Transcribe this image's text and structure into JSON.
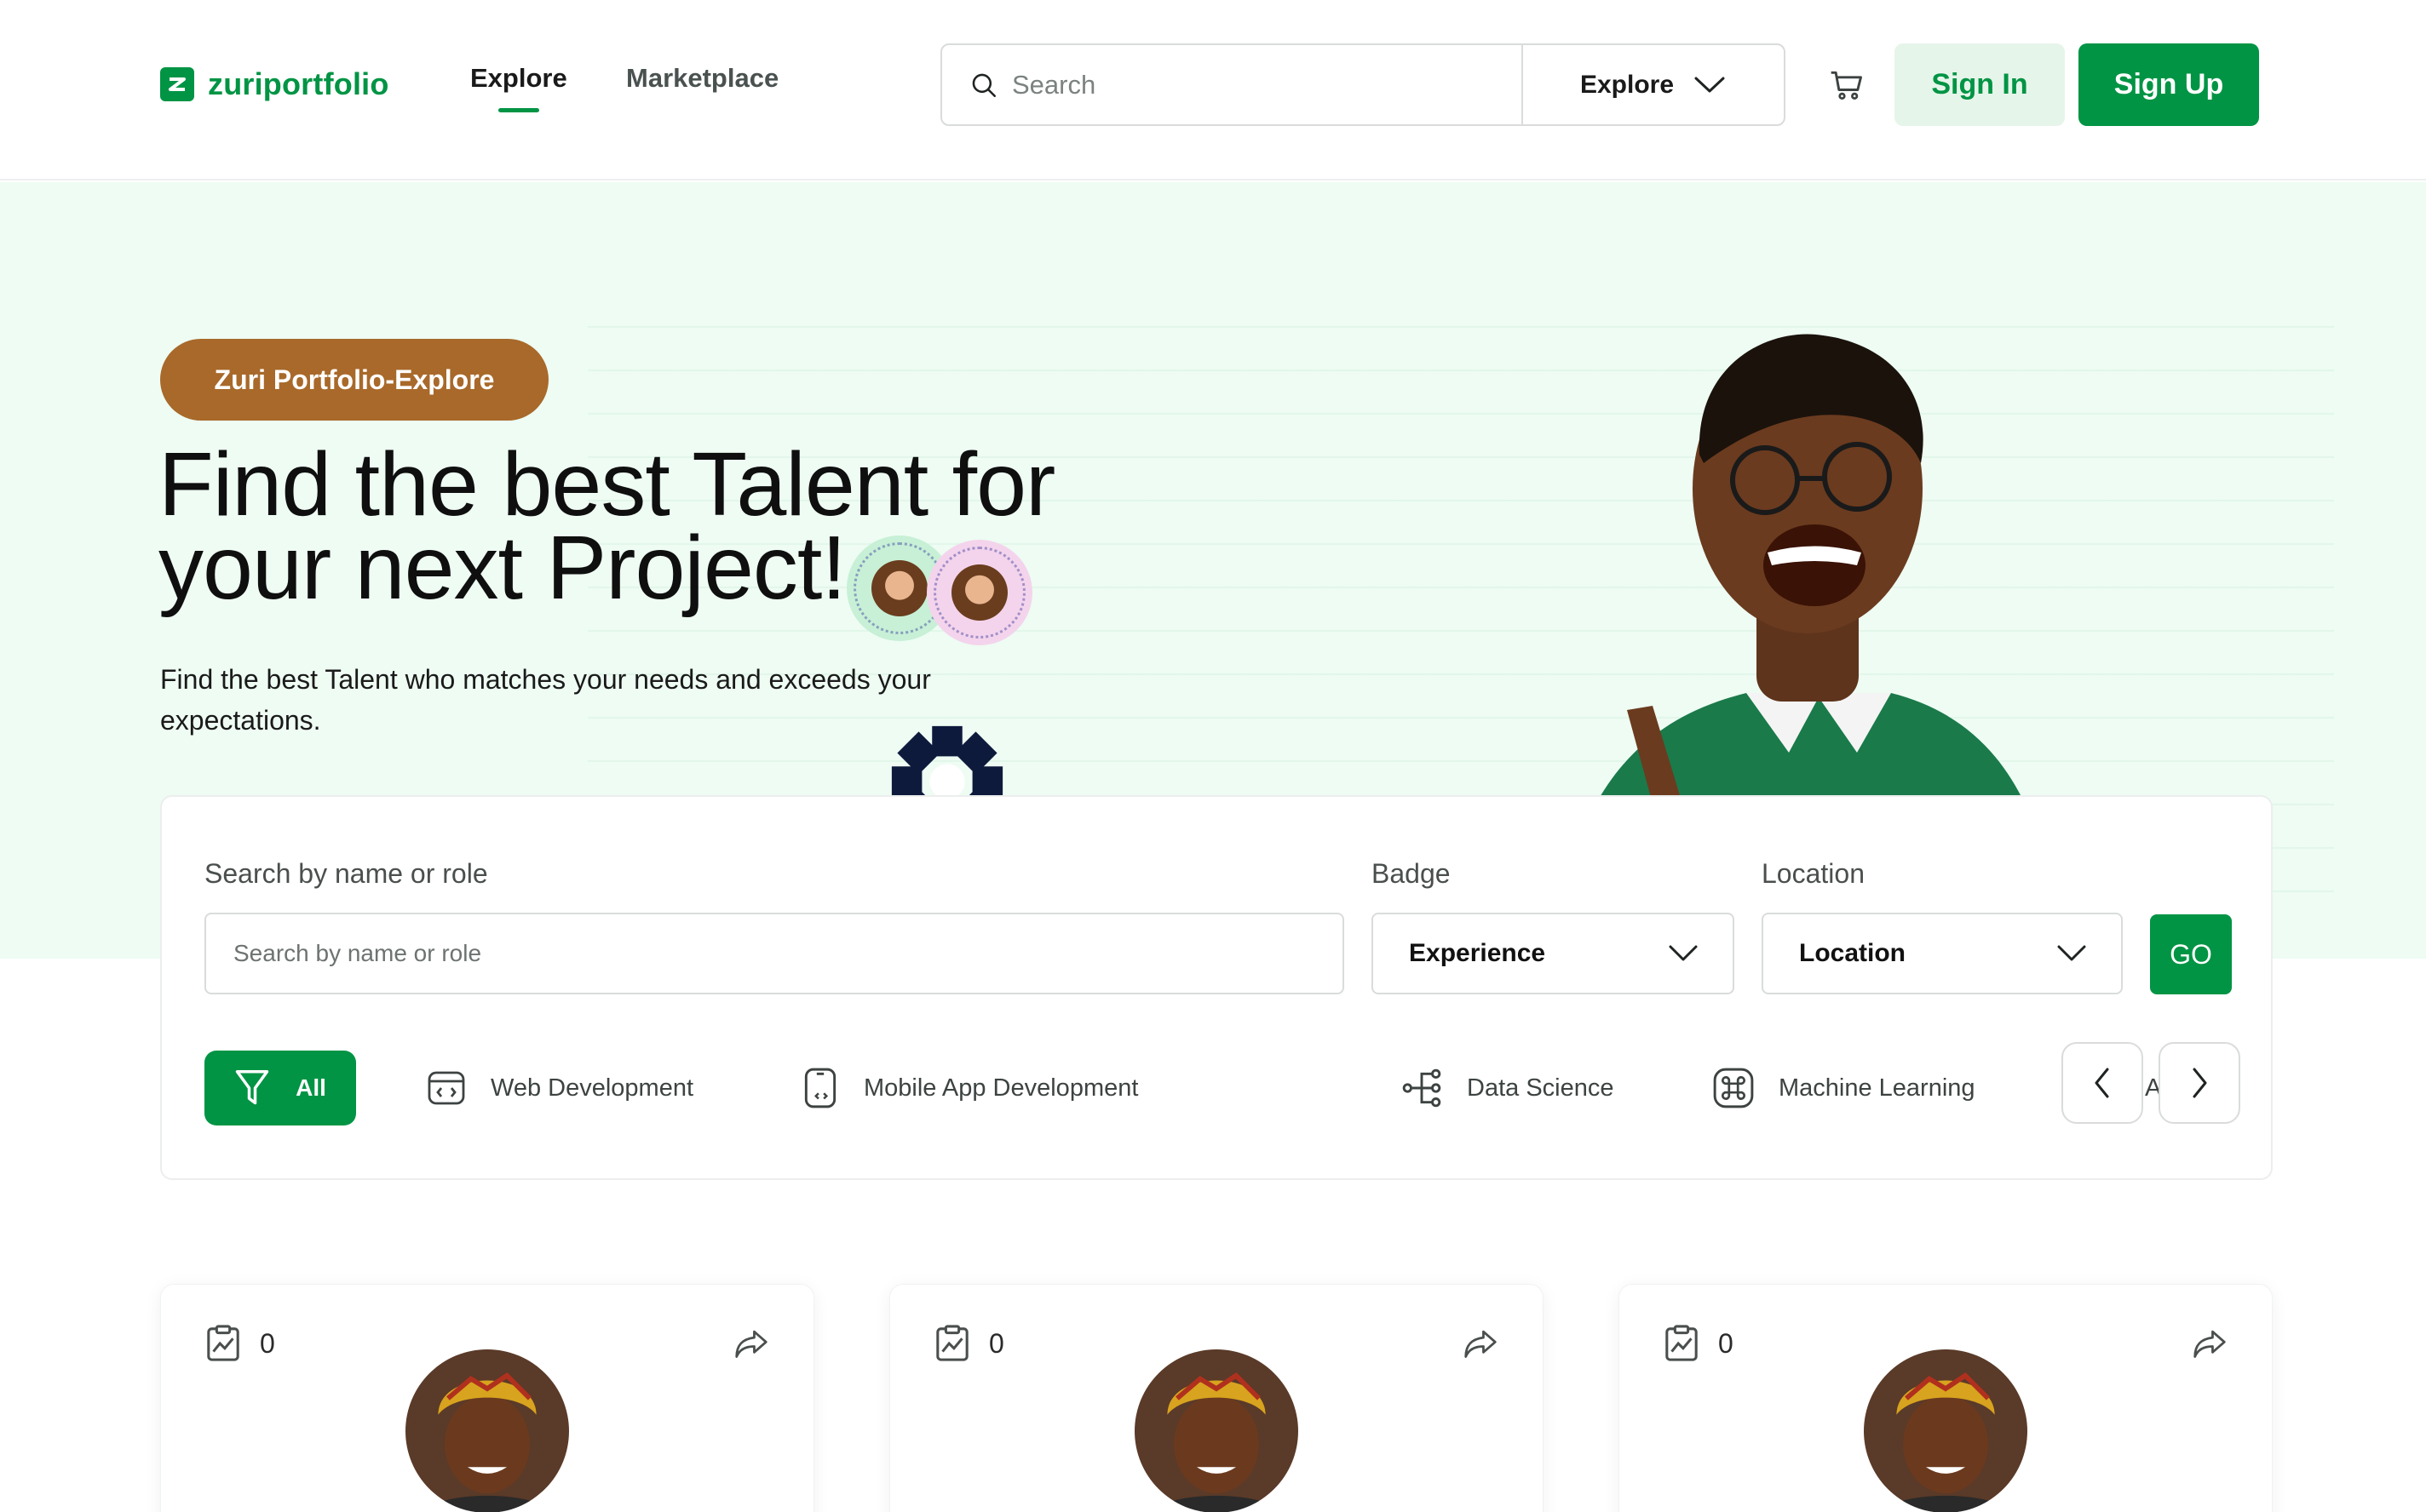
{
  "brand": {
    "name": "zuriportfolio",
    "color": "#009444"
  },
  "nav": {
    "links": [
      {
        "label": "Explore",
        "active": true
      },
      {
        "label": "Marketplace",
        "active": false
      }
    ],
    "search_placeholder": "Search",
    "explore_dropdown": "Explore",
    "sign_in": "Sign In",
    "sign_up": "Sign Up"
  },
  "hero": {
    "pill": "Zuri Portfolio-Explore",
    "title_line1": "Find the best Talent for",
    "title_line2": "your next Project!",
    "subtitle_line1": "Find the best Talent who matches your needs and exceeds your",
    "subtitle_line2": "expectations.",
    "background": "#eefcf3"
  },
  "filters": {
    "search_label": "Search by name or role",
    "search_placeholder": "Search by name or role",
    "badge_label": "Badge",
    "badge_value": "Experience",
    "location_label": "Location",
    "location_value": "Location",
    "go": "GO",
    "categories": [
      {
        "label": "All",
        "icon": "funnel-icon",
        "active": true
      },
      {
        "label": "Web Development",
        "icon": "browser-code-icon"
      },
      {
        "label": "Mobile App Development",
        "icon": "mobile-code-icon"
      },
      {
        "label": "Data Science",
        "icon": "data-tree-icon"
      },
      {
        "label": "Machine Learning",
        "icon": "command-icon"
      },
      {
        "label": "Artific",
        "icon": "command-icon"
      }
    ]
  },
  "profiles": [
    {
      "projects": "0"
    },
    {
      "projects": "0"
    },
    {
      "projects": "0"
    }
  ]
}
